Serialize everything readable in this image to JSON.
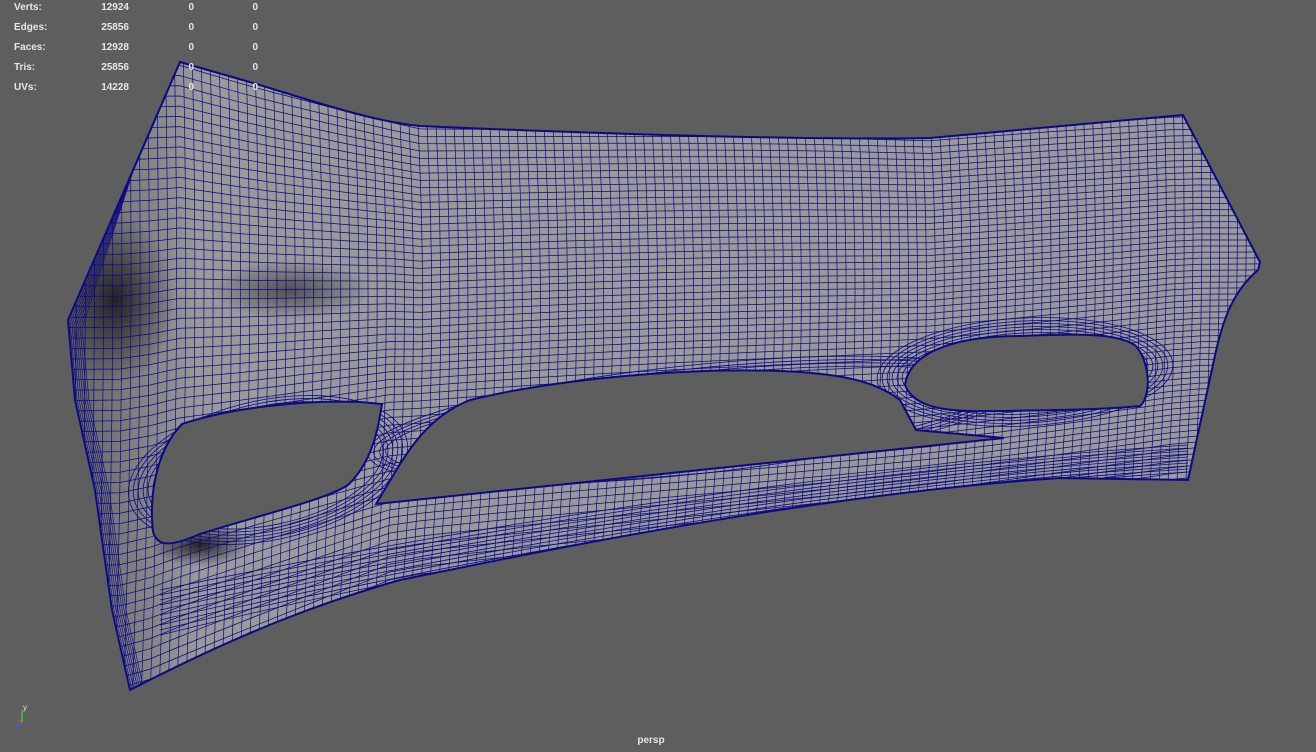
{
  "viewport": {
    "camera_label": "persp",
    "background": "#5e5e5e",
    "wire_color": "#0c0a82",
    "surface_color": "#9a9a9a"
  },
  "hud": {
    "rows": [
      {
        "label": "Verts:",
        "v1": "12924",
        "v2": "0",
        "v3": "0"
      },
      {
        "label": "Edges:",
        "v1": "25856",
        "v2": "0",
        "v3": "0"
      },
      {
        "label": "Faces:",
        "v1": "12928",
        "v2": "0",
        "v3": "0"
      },
      {
        "label": "Tris:",
        "v1": "25856",
        "v2": "0",
        "v3": "0"
      },
      {
        "label": "UVs:",
        "v1": "14228",
        "v2": "0",
        "v3": "0"
      }
    ]
  },
  "axis_gizmo": {
    "y_label": "y",
    "x_color": "#e04040",
    "y_color": "#40d040",
    "z_color": "#4060ff"
  }
}
